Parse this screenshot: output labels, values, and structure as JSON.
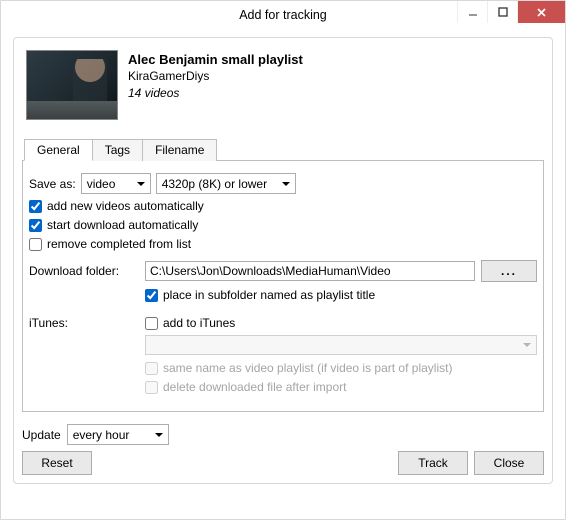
{
  "window": {
    "title": "Add for tracking"
  },
  "playlist": {
    "title": "Alec Benjamin small playlist",
    "owner": "KiraGamerDiys",
    "count_text": "14 videos"
  },
  "tabs": {
    "general": "General",
    "tags": "Tags",
    "filename": "Filename"
  },
  "general": {
    "save_as_label": "Save as:",
    "format": "video",
    "quality": "4320p (8K) or lower",
    "add_new": "add new videos automatically",
    "start_download": "start download automatically",
    "remove_completed": "remove completed from list",
    "download_folder_label": "Download folder:",
    "download_folder_path": "C:\\Users\\Jon\\Downloads\\MediaHuman\\Video",
    "browse_btn": "...",
    "place_in_subfolder": "place in subfolder named as playlist title",
    "itunes_label": "iTunes:",
    "add_to_itunes": "add to iTunes",
    "same_name": "same name as video playlist (if video is part of playlist)",
    "delete_after_import": "delete downloaded file after import"
  },
  "footer": {
    "update_label": "Update",
    "update_interval": "every hour",
    "reset_btn": "Reset",
    "track_btn": "Track",
    "close_btn": "Close"
  }
}
